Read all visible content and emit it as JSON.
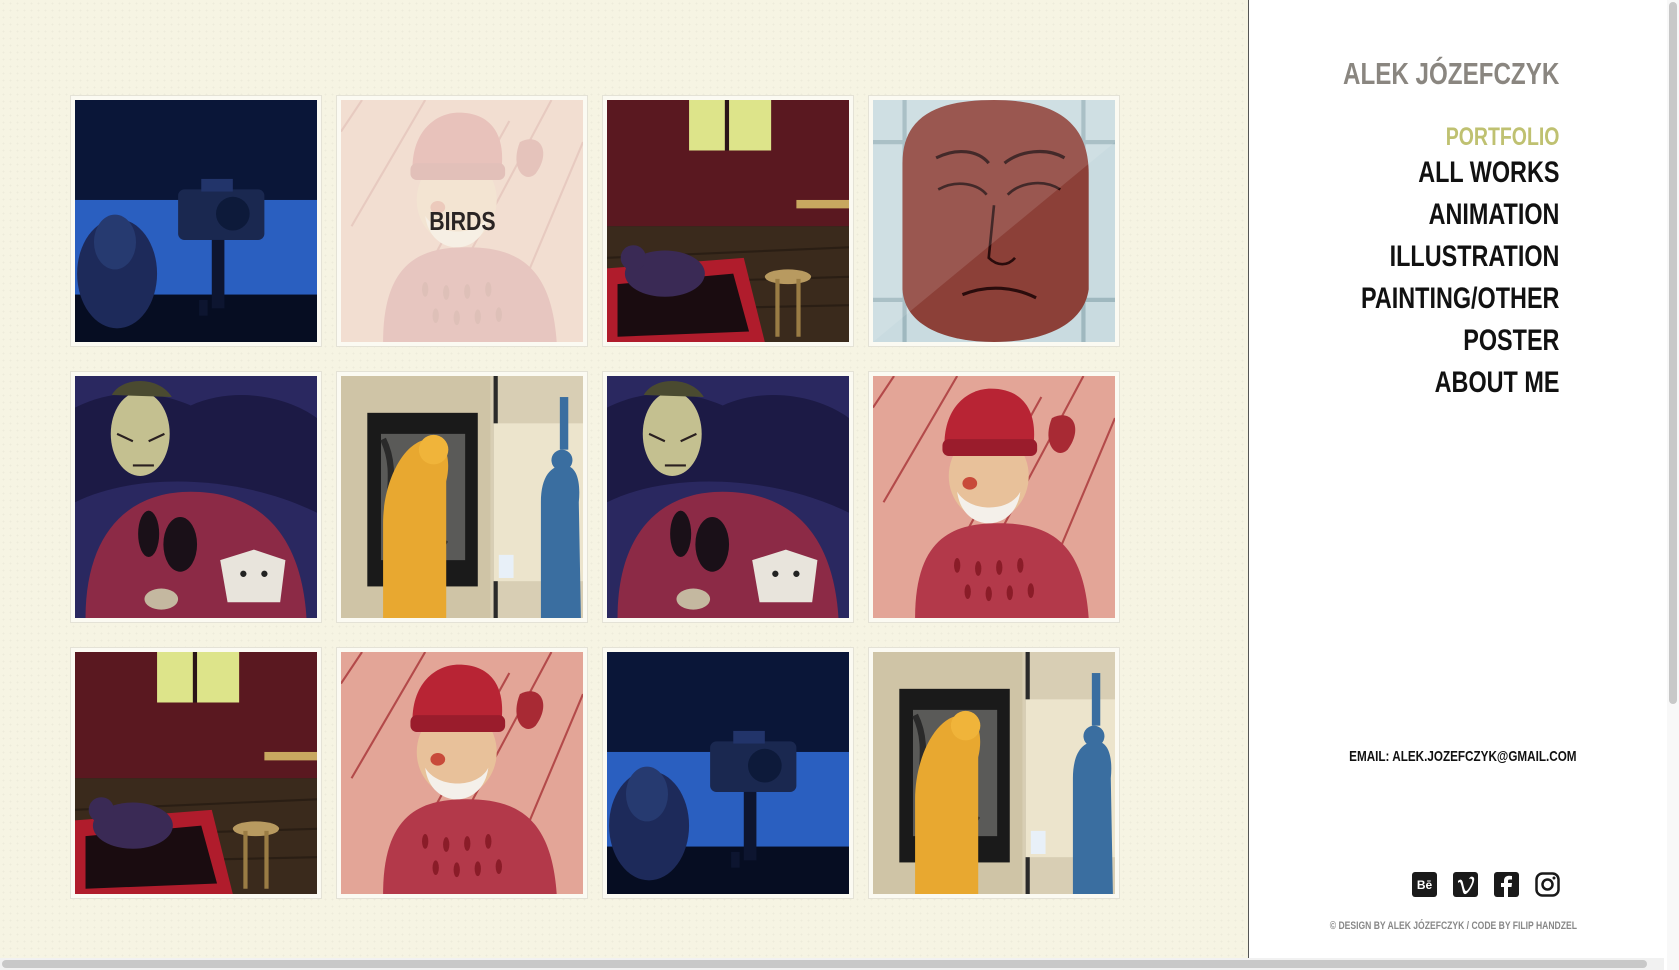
{
  "site": {
    "title": "ALEK JÓZEFCZYK"
  },
  "nav": {
    "heading": "PORTFOLIO",
    "items": [
      {
        "label": "ALL WORKS"
      },
      {
        "label": "ANIMATION"
      },
      {
        "label": "ILLUSTRATION"
      },
      {
        "label": "PAINTING/OTHER"
      },
      {
        "label": "POSTER"
      },
      {
        "label": "ABOUT ME"
      }
    ]
  },
  "gallery": {
    "hover_label": "BIRDS",
    "tiles": [
      {
        "artwork": "camera-night"
      },
      {
        "artwork": "old-man-red-hat"
      },
      {
        "artwork": "dark-room-cat"
      },
      {
        "artwork": "bald-face"
      },
      {
        "artwork": "zombie-man-cat"
      },
      {
        "artwork": "painters-diptych"
      },
      {
        "artwork": "zombie-man-cat"
      },
      {
        "artwork": "old-man-red-hat"
      },
      {
        "artwork": "dark-room-cat"
      },
      {
        "artwork": "old-man-red-hat"
      },
      {
        "artwork": "camera-night"
      },
      {
        "artwork": "painters-diptych"
      }
    ]
  },
  "footer": {
    "email": "EMAIL: ALEK.JOZEFCZYK@GMAIL.COM",
    "credits": "© DESIGN BY ALEK JÓZEFCZYK / CODE BY FILIP HANDZEL",
    "socials": [
      "behance-icon",
      "vimeo-icon",
      "facebook-icon",
      "instagram-icon"
    ]
  },
  "colors": {
    "accent": "#bfc171",
    "background": "#f6f4e3"
  }
}
